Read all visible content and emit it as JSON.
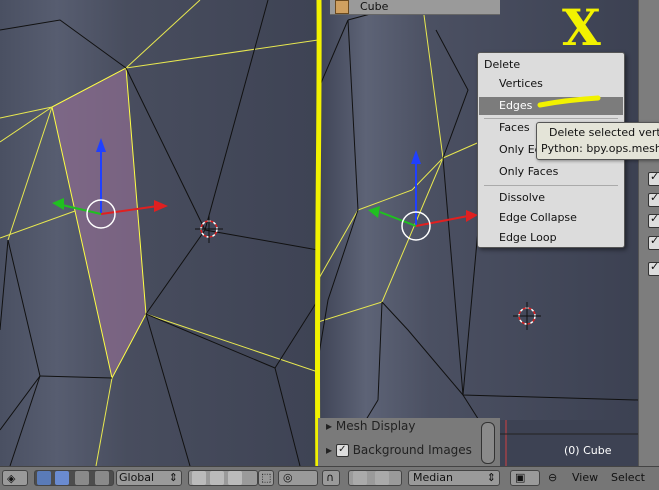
{
  "object_header": {
    "name": "Cube"
  },
  "annotation": {
    "x_letter": "X"
  },
  "delete_menu": {
    "title": "Delete",
    "items": [
      {
        "label": "Vertices"
      },
      {
        "label": "Edges"
      },
      {
        "label": "Faces"
      },
      {
        "label": "Only Edges & Faces"
      },
      {
        "label": "Only Faces"
      },
      {
        "label": "Dissolve"
      },
      {
        "label": "Edge Collapse"
      },
      {
        "label": "Edge Loop"
      }
    ]
  },
  "tooltip": {
    "line1": "Delete selected vertices, edges or faces",
    "line2": "Python: bpy.ops.mesh.delete(type='EDGE')"
  },
  "properties": {
    "mesh_display": "Mesh Display",
    "background_images": "Background Images"
  },
  "mini_view": {
    "label": "(0) Cube"
  },
  "toolbar": {
    "orientation": "Global",
    "pivot": "Median",
    "view_menu": "View",
    "select_menu": "Select"
  },
  "colors": {
    "annotation_yellow": "#f2f200",
    "selected_face": "#8a6b8e",
    "selected_edge": "#ffff44",
    "axis_x": "#e02020",
    "axis_y": "#20c020",
    "axis_z": "#2040ff"
  }
}
